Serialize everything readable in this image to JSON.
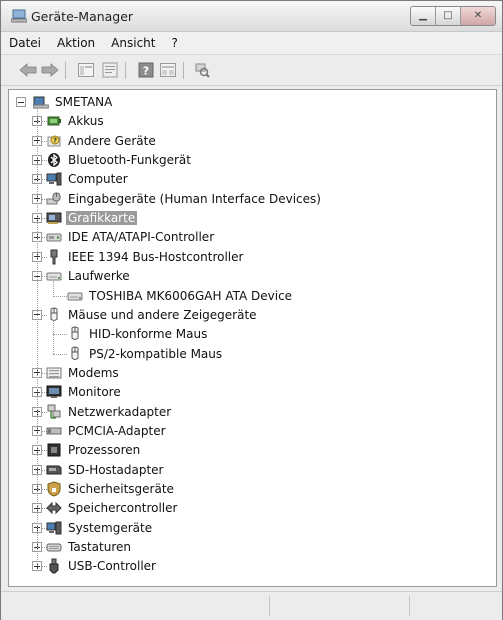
{
  "window": {
    "title": "Geräte-Manager"
  },
  "menu": [
    "Datei",
    "Aktion",
    "Ansicht",
    "?"
  ],
  "toolbar": {
    "buttons": [
      "back-icon",
      "forward-icon",
      "show-hide-tree-icon",
      "properties-icon",
      "help-icon",
      "view-icon",
      "scan-hardware-icon"
    ]
  },
  "tree": {
    "root": "SMETANA",
    "categories": [
      {
        "label": "Akkus",
        "icon": "battery-icon",
        "expanded": false
      },
      {
        "label": "Andere Geräte",
        "icon": "unknown-device-icon",
        "expanded": false
      },
      {
        "label": "Bluetooth-Funkgerät",
        "icon": "bluetooth-icon",
        "expanded": false
      },
      {
        "label": "Computer",
        "icon": "computer-icon",
        "expanded": false
      },
      {
        "label": "Eingabegeräte (Human Interface Devices)",
        "icon": "hid-icon",
        "expanded": false
      },
      {
        "label": "Grafikkarte",
        "icon": "display-adapter-icon",
        "expanded": false,
        "selected": true
      },
      {
        "label": "IDE ATA/ATAPI-Controller",
        "icon": "ide-controller-icon",
        "expanded": false
      },
      {
        "label": "IEEE 1394 Bus-Hostcontroller",
        "icon": "firewire-icon",
        "expanded": false
      },
      {
        "label": "Laufwerke",
        "icon": "disk-drive-icon",
        "expanded": true,
        "children": [
          {
            "label": "TOSHIBA MK6006GAH ATA Device",
            "icon": "disk-drive-icon"
          }
        ]
      },
      {
        "label": "Mäuse und andere Zeigegeräte",
        "icon": "mouse-icon",
        "expanded": true,
        "children": [
          {
            "label": "HID-konforme Maus",
            "icon": "mouse-icon"
          },
          {
            "label": "PS/2-kompatible Maus",
            "icon": "mouse-icon"
          }
        ]
      },
      {
        "label": "Modems",
        "icon": "modem-icon",
        "expanded": false
      },
      {
        "label": "Monitore",
        "icon": "monitor-icon",
        "expanded": false
      },
      {
        "label": "Netzwerkadapter",
        "icon": "network-adapter-icon",
        "expanded": false
      },
      {
        "label": "PCMCIA-Adapter",
        "icon": "pcmcia-icon",
        "expanded": false
      },
      {
        "label": "Prozessoren",
        "icon": "processor-icon",
        "expanded": false
      },
      {
        "label": "SD-Hostadapter",
        "icon": "sd-host-icon",
        "expanded": false
      },
      {
        "label": "Sicherheitsgeräte",
        "icon": "security-device-icon",
        "expanded": false
      },
      {
        "label": "Speichercontroller",
        "icon": "storage-controller-icon",
        "expanded": false
      },
      {
        "label": "Systemgeräte",
        "icon": "system-device-icon",
        "expanded": false
      },
      {
        "label": "Tastaturen",
        "icon": "keyboard-icon",
        "expanded": false
      },
      {
        "label": "USB-Controller",
        "icon": "usb-icon",
        "expanded": false
      }
    ]
  },
  "status": {
    "cells": [
      "",
      "",
      ""
    ]
  }
}
